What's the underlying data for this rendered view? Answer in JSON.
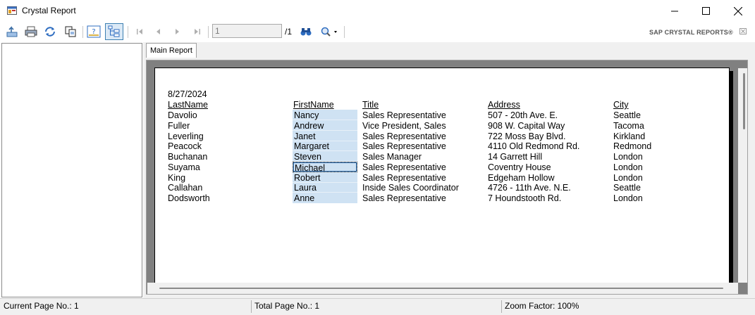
{
  "window": {
    "title": "Crystal Report"
  },
  "toolbar": {
    "buttons": [
      {
        "icon": "export-icon"
      },
      {
        "icon": "print-icon"
      },
      {
        "icon": "refresh-icon"
      },
      {
        "icon": "copy-icon"
      },
      {
        "icon": "parameter-panel-icon"
      },
      {
        "icon": "group-tree-icon"
      },
      {
        "icon": "first-page-icon"
      },
      {
        "icon": "previous-page-icon"
      },
      {
        "icon": "next-page-icon"
      },
      {
        "icon": "last-page-icon"
      },
      {
        "icon": "find-binoculars-icon"
      },
      {
        "icon": "zoom-icon"
      }
    ],
    "page_value": "1",
    "page_total": "/1",
    "brand": "SAP CRYSTAL REPORTS®"
  },
  "tabs": {
    "main": "Main Report"
  },
  "report": {
    "date": "8/27/2024",
    "headers": {
      "last_name": "LastName",
      "first_name": "FirstName",
      "title": "Title",
      "address": "Address",
      "city": "City"
    },
    "rows": [
      {
        "last_name": "Davolio",
        "first_name": "Nancy",
        "title": "Sales Representative",
        "address": "507 - 20th Ave. E.",
        "city": "Seattle"
      },
      {
        "last_name": "Fuller",
        "first_name": "Andrew",
        "title": "Vice President, Sales",
        "address": "908 W. Capital Way",
        "city": "Tacoma"
      },
      {
        "last_name": "Leverling",
        "first_name": "Janet",
        "title": "Sales Representative",
        "address": "722 Moss Bay Blvd.",
        "city": "Kirkland"
      },
      {
        "last_name": "Peacock",
        "first_name": "Margaret",
        "title": "Sales Representative",
        "address": "4110 Old Redmond Rd.",
        "city": "Redmond"
      },
      {
        "last_name": "Buchanan",
        "first_name": "Steven",
        "title": "Sales Manager",
        "address": "14 Garrett Hill",
        "city": "London"
      },
      {
        "last_name": "Suyama",
        "first_name": "Michael",
        "title": "Sales Representative",
        "address": "Coventry House",
        "city": "London"
      },
      {
        "last_name": "King",
        "first_name": "Robert",
        "title": "Sales Representative",
        "address": "Edgeham Hollow",
        "city": "London"
      },
      {
        "last_name": "Callahan",
        "first_name": "Laura",
        "title": "Inside Sales Coordinator",
        "address": "4726 - 11th Ave. N.E.",
        "city": "Seattle"
      },
      {
        "last_name": "Dodsworth",
        "first_name": "Anne",
        "title": "Sales Representative",
        "address": "7 Houndstooth Rd.",
        "city": "London"
      }
    ],
    "selected_row": 5
  },
  "statusbar": {
    "current_page": "Current Page No.: 1",
    "total_page": "Total Page No.: 1",
    "zoom": "Zoom Factor: 100%"
  }
}
